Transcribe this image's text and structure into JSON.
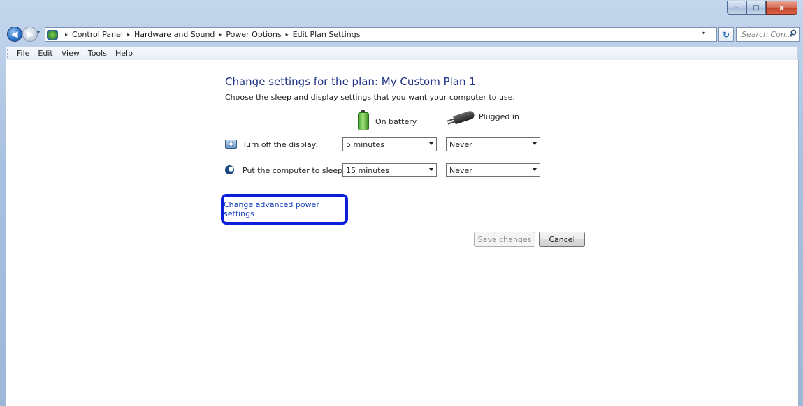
{
  "window": {
    "caption_buttons": {
      "minimize": "–",
      "maximize": "□",
      "close": "x"
    }
  },
  "nav": {
    "back_glyph": "◀",
    "forward_glyph": "▶",
    "recent_glyph": "▾",
    "back_icon": "back-arrow-icon",
    "forward_icon": "forward-arrow-icon"
  },
  "address_bar": {
    "root_separator": "▸",
    "breadcrumbs": [
      "Control Panel",
      "Hardware and Sound",
      "Power Options",
      "Edit Plan Settings"
    ],
    "dropdown_glyph": "▾",
    "refresh_glyph": "↻"
  },
  "search": {
    "placeholder": "Search Con...",
    "icon": "search-icon"
  },
  "menu": [
    "File",
    "Edit",
    "View",
    "Tools",
    "Help"
  ],
  "main": {
    "title": "Change settings for the plan: My Custom Plan 1",
    "subtitle": "Choose the sleep and display settings that you want your computer to use.",
    "columns": {
      "on_battery": "On battery",
      "plugged_in": "Plugged in"
    },
    "settings": [
      {
        "label": "Turn off the display:",
        "icon": "monitor-icon",
        "on_battery": "5 minutes",
        "plugged_in": "Never"
      },
      {
        "label": "Put the computer to sleep:",
        "icon": "moon-icon",
        "on_battery": "15 minutes",
        "plugged_in": "Never"
      }
    ],
    "advanced_link": "Change advanced power settings"
  },
  "buttons": {
    "save": "Save changes",
    "cancel": "Cancel"
  },
  "colors": {
    "highlight_border": "#0b1fd8",
    "link": "#0f3bb8",
    "heading": "#1e3287"
  }
}
